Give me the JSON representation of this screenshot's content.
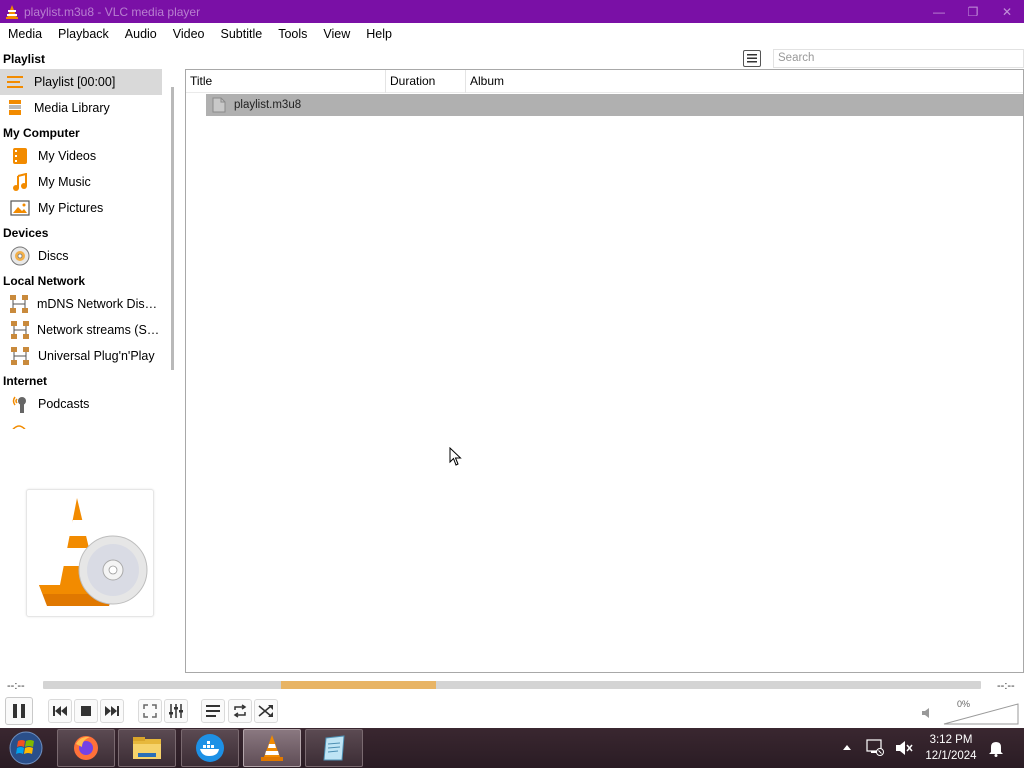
{
  "window": {
    "title": "playlist.m3u8 - VLC media player",
    "controls": {
      "minimize": "—",
      "maximize": "❐",
      "close": "✕"
    }
  },
  "menubar": [
    "Media",
    "Playback",
    "Audio",
    "Video",
    "Subtitle",
    "Tools",
    "View",
    "Help"
  ],
  "sidebar": {
    "sections": [
      {
        "heading": "Playlist",
        "items": [
          {
            "label": "Playlist [00:00]",
            "icon": "playlist-icon",
            "selected": true
          },
          {
            "label": "Media Library",
            "icon": "media-library-icon"
          }
        ]
      },
      {
        "heading": "My Computer",
        "items": [
          {
            "label": "My Videos",
            "icon": "videos-icon"
          },
          {
            "label": "My Music",
            "icon": "music-icon"
          },
          {
            "label": "My Pictures",
            "icon": "pictures-icon"
          }
        ]
      },
      {
        "heading": "Devices",
        "items": [
          {
            "label": "Discs",
            "icon": "disc-icon"
          }
        ]
      },
      {
        "heading": "Local Network",
        "items": [
          {
            "label": "mDNS Network Disco...",
            "icon": "network-icon"
          },
          {
            "label": "Network streams (SAP)",
            "icon": "network-icon"
          },
          {
            "label": "Universal Plug'n'Play",
            "icon": "network-icon"
          }
        ]
      },
      {
        "heading": "Internet",
        "items": [
          {
            "label": "Podcasts",
            "icon": "podcast-icon"
          }
        ]
      }
    ]
  },
  "search": {
    "placeholder": "Search"
  },
  "playlist": {
    "columns": [
      "Title",
      "Duration",
      "Album"
    ],
    "rows": [
      {
        "title": "playlist.m3u8",
        "duration": "",
        "album": ""
      }
    ]
  },
  "seek": {
    "elapsed": "--:--",
    "remaining": "--:--"
  },
  "volume": {
    "percent": "0%"
  },
  "taskbar": {
    "apps": [
      "firefox",
      "file-explorer",
      "docker",
      "vlc",
      "notepad"
    ],
    "clock_time": "3:12 PM",
    "clock_date": "12/1/2024"
  },
  "colors": {
    "titlebar": "#7a10a6",
    "selection": "#d9d9d9",
    "row_selected": "#b0b0b0",
    "buffer": "#e8b465",
    "vlc_orange": "#f28b00"
  }
}
